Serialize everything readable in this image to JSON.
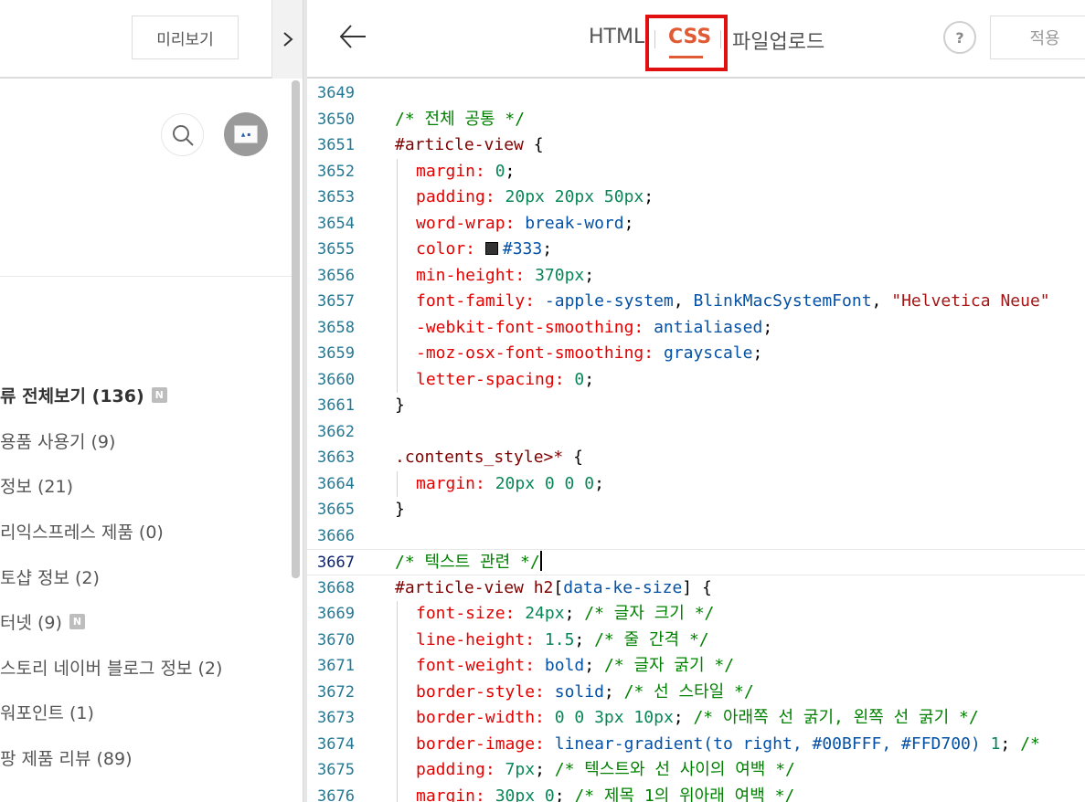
{
  "left_pane": {
    "preview_label": "미리보기",
    "categories": [
      {
        "label": "류 전체보기 (136)",
        "badge": "N"
      },
      {
        "label": "용품 사용기 (9)"
      },
      {
        "label": "정보 (21)"
      },
      {
        "label": "리익스프레스 제품 (0)"
      },
      {
        "label": "토샵 정보 (2)"
      },
      {
        "label": "터넷 (9)",
        "badge": "N"
      },
      {
        "label": "스토리 네이버 블로그 정보 (2)"
      },
      {
        "label": "워포인트 (1)"
      },
      {
        "label": "팡 제품 리뷰 (89)"
      }
    ]
  },
  "editor": {
    "tabs": {
      "html": "HTML",
      "css": "CSS",
      "upload": "파일업로드"
    },
    "active_tab": "CSS",
    "help_label": "?",
    "apply_label": "적용",
    "accent_color": "#e05a33",
    "highlight_color": "#e01010",
    "active_line": "3667",
    "lines": [
      {
        "n": "3649",
        "tokens": []
      },
      {
        "n": "3650",
        "tokens": [
          {
            "t": "/* 전체 공통 */",
            "c": "c-comment"
          }
        ]
      },
      {
        "n": "3651",
        "tokens": [
          {
            "t": "#article-view",
            "c": "c-selector"
          },
          {
            "t": " {",
            "c": "c-punc"
          }
        ]
      },
      {
        "n": "3652",
        "indent": true,
        "tokens": [
          {
            "t": "margin:",
            "c": "c-prop"
          },
          {
            "t": " ",
            "c": "c-punc"
          },
          {
            "t": "0",
            "c": "c-num"
          },
          {
            "t": ";",
            "c": "c-punc"
          }
        ]
      },
      {
        "n": "3653",
        "indent": true,
        "tokens": [
          {
            "t": "padding:",
            "c": "c-prop"
          },
          {
            "t": " ",
            "c": "c-punc"
          },
          {
            "t": "20px 20px 50px",
            "c": "c-num"
          },
          {
            "t": ";",
            "c": "c-punc"
          }
        ]
      },
      {
        "n": "3654",
        "indent": true,
        "tokens": [
          {
            "t": "word-wrap:",
            "c": "c-prop"
          },
          {
            "t": " ",
            "c": "c-punc"
          },
          {
            "t": "break-word",
            "c": "c-val"
          },
          {
            "t": ";",
            "c": "c-punc"
          }
        ]
      },
      {
        "n": "3655",
        "indent": true,
        "swatch": true,
        "tokens": [
          {
            "t": "color:",
            "c": "c-prop"
          },
          {
            "t": " ",
            "c": "c-punc"
          },
          {
            "t": "#333",
            "c": "c-val",
            "swatch": true
          },
          {
            "t": ";",
            "c": "c-punc"
          }
        ]
      },
      {
        "n": "3656",
        "indent": true,
        "tokens": [
          {
            "t": "min-height:",
            "c": "c-prop"
          },
          {
            "t": " ",
            "c": "c-punc"
          },
          {
            "t": "370px",
            "c": "c-num"
          },
          {
            "t": ";",
            "c": "c-punc"
          }
        ]
      },
      {
        "n": "3657",
        "indent": true,
        "tokens": [
          {
            "t": "font-family:",
            "c": "c-prop"
          },
          {
            "t": " ",
            "c": "c-punc"
          },
          {
            "t": "-apple-system",
            "c": "c-val"
          },
          {
            "t": ", ",
            "c": "c-punc"
          },
          {
            "t": "BlinkMacSystemFont",
            "c": "c-val"
          },
          {
            "t": ", ",
            "c": "c-punc"
          },
          {
            "t": "\"Helvetica Neue\"",
            "c": "c-str"
          }
        ]
      },
      {
        "n": "3658",
        "indent": true,
        "tokens": [
          {
            "t": "-webkit-font-smoothing:",
            "c": "c-prop"
          },
          {
            "t": " ",
            "c": "c-punc"
          },
          {
            "t": "antialiased",
            "c": "c-val"
          },
          {
            "t": ";",
            "c": "c-punc"
          }
        ]
      },
      {
        "n": "3659",
        "indent": true,
        "tokens": [
          {
            "t": "-moz-osx-font-smoothing:",
            "c": "c-prop"
          },
          {
            "t": " ",
            "c": "c-punc"
          },
          {
            "t": "grayscale",
            "c": "c-val"
          },
          {
            "t": ";",
            "c": "c-punc"
          }
        ]
      },
      {
        "n": "3660",
        "indent": true,
        "tokens": [
          {
            "t": "letter-spacing:",
            "c": "c-prop"
          },
          {
            "t": " ",
            "c": "c-punc"
          },
          {
            "t": "0",
            "c": "c-num"
          },
          {
            "t": ";",
            "c": "c-punc"
          }
        ]
      },
      {
        "n": "3661",
        "tokens": [
          {
            "t": "}",
            "c": "c-punc"
          }
        ]
      },
      {
        "n": "3662",
        "tokens": []
      },
      {
        "n": "3663",
        "tokens": [
          {
            "t": ".contents_style>*",
            "c": "c-selector"
          },
          {
            "t": " {",
            "c": "c-punc"
          }
        ]
      },
      {
        "n": "3664",
        "indent": true,
        "tokens": [
          {
            "t": "margin:",
            "c": "c-prop"
          },
          {
            "t": " ",
            "c": "c-punc"
          },
          {
            "t": "20px 0 0 0",
            "c": "c-num"
          },
          {
            "t": ";",
            "c": "c-punc"
          }
        ]
      },
      {
        "n": "3665",
        "tokens": [
          {
            "t": "}",
            "c": "c-punc"
          }
        ]
      },
      {
        "n": "3666",
        "tokens": []
      },
      {
        "n": "3667",
        "cursor": true,
        "tokens": [
          {
            "t": "/* 텍스트 관련 */",
            "c": "c-comment"
          }
        ]
      },
      {
        "n": "3668",
        "tokens": [
          {
            "t": "#article-view h2",
            "c": "c-selector"
          },
          {
            "t": "[",
            "c": "c-punc"
          },
          {
            "t": "data-ke-size",
            "c": "c-val"
          },
          {
            "t": "] {",
            "c": "c-punc"
          }
        ]
      },
      {
        "n": "3669",
        "indent": true,
        "tokens": [
          {
            "t": "font-size:",
            "c": "c-prop"
          },
          {
            "t": " ",
            "c": "c-punc"
          },
          {
            "t": "24px",
            "c": "c-num"
          },
          {
            "t": "; ",
            "c": "c-punc"
          },
          {
            "t": "/* 글자 크기 */",
            "c": "c-comment"
          }
        ]
      },
      {
        "n": "3670",
        "indent": true,
        "tokens": [
          {
            "t": "line-height:",
            "c": "c-prop"
          },
          {
            "t": " ",
            "c": "c-punc"
          },
          {
            "t": "1.5",
            "c": "c-num"
          },
          {
            "t": "; ",
            "c": "c-punc"
          },
          {
            "t": "/* 줄 간격 */",
            "c": "c-comment"
          }
        ]
      },
      {
        "n": "3671",
        "indent": true,
        "tokens": [
          {
            "t": "font-weight:",
            "c": "c-prop"
          },
          {
            "t": " ",
            "c": "c-punc"
          },
          {
            "t": "bold",
            "c": "c-val"
          },
          {
            "t": "; ",
            "c": "c-punc"
          },
          {
            "t": "/* 글자 굵기 */",
            "c": "c-comment"
          }
        ]
      },
      {
        "n": "3672",
        "indent": true,
        "tokens": [
          {
            "t": "border-style:",
            "c": "c-prop"
          },
          {
            "t": " ",
            "c": "c-punc"
          },
          {
            "t": "solid",
            "c": "c-val"
          },
          {
            "t": "; ",
            "c": "c-punc"
          },
          {
            "t": "/* 선 스타일 */",
            "c": "c-comment"
          }
        ]
      },
      {
        "n": "3673",
        "indent": true,
        "tokens": [
          {
            "t": "border-width:",
            "c": "c-prop"
          },
          {
            "t": " ",
            "c": "c-punc"
          },
          {
            "t": "0 0 3px 10px",
            "c": "c-num"
          },
          {
            "t": "; ",
            "c": "c-punc"
          },
          {
            "t": "/* 아래쪽 선 굵기, 왼쪽 선 굵기 */",
            "c": "c-comment"
          }
        ]
      },
      {
        "n": "3674",
        "indent": true,
        "tokens": [
          {
            "t": "border-image:",
            "c": "c-prop"
          },
          {
            "t": " ",
            "c": "c-punc"
          },
          {
            "t": "linear-gradient(to right, #00BFFF, #FFD700)",
            "c": "c-val"
          },
          {
            "t": " ",
            "c": "c-punc"
          },
          {
            "t": "1",
            "c": "c-num"
          },
          {
            "t": "; ",
            "c": "c-punc"
          },
          {
            "t": "/*",
            "c": "c-comment"
          }
        ]
      },
      {
        "n": "3675",
        "indent": true,
        "tokens": [
          {
            "t": "padding:",
            "c": "c-prop"
          },
          {
            "t": " ",
            "c": "c-punc"
          },
          {
            "t": "7px",
            "c": "c-num"
          },
          {
            "t": "; ",
            "c": "c-punc"
          },
          {
            "t": "/* 텍스트와 선 사이의 여백 */",
            "c": "c-comment"
          }
        ]
      },
      {
        "n": "3676",
        "indent": true,
        "tokens": [
          {
            "t": "margin:",
            "c": "c-prop"
          },
          {
            "t": " ",
            "c": "c-punc"
          },
          {
            "t": "30px 0",
            "c": "c-num"
          },
          {
            "t": "; ",
            "c": "c-punc"
          },
          {
            "t": "/* 제목 1의 위아래 여백 */",
            "c": "c-comment"
          }
        ]
      }
    ]
  }
}
